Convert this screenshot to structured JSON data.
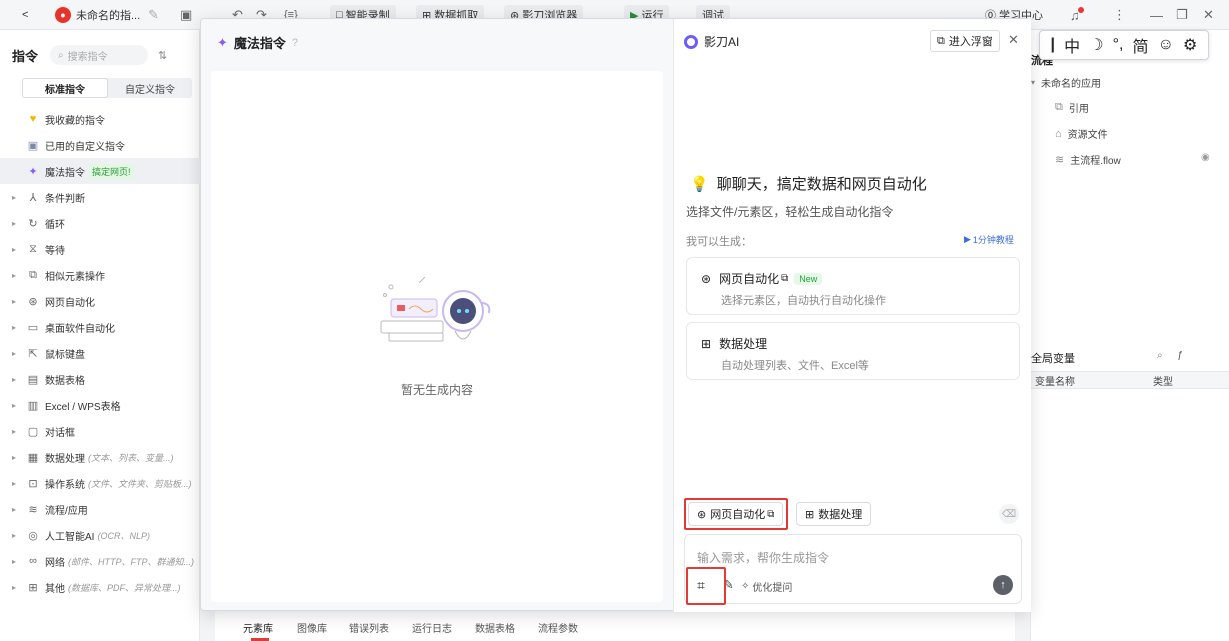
{
  "topbar": {
    "back": "<",
    "app_title": "未命名的指...",
    "smart_record": "智能录制",
    "data_capture": "数据抓取",
    "browser": "影刀浏览器",
    "run": "运行",
    "debug": "调试",
    "learn": "学习中心",
    "window_controls": [
      "⋮",
      "—",
      "❐",
      "✕"
    ]
  },
  "sidebar": {
    "title": "指令",
    "search_placeholder": "搜索指令",
    "tabs": [
      "标准指令",
      "自定义指令"
    ],
    "special_rows": [
      {
        "icon": "heart-icon",
        "label": "我收藏的指令"
      },
      {
        "icon": "bag-icon",
        "label": "已用的自定义指令"
      },
      {
        "icon": "sparkle-icon",
        "label": "魔法指令",
        "tag": "搞定网页!"
      }
    ],
    "groups": [
      {
        "label": "条件判断",
        "hint": ""
      },
      {
        "label": "循环",
        "hint": ""
      },
      {
        "label": "等待",
        "hint": ""
      },
      {
        "label": "相似元素操作",
        "hint": ""
      },
      {
        "label": "网页自动化",
        "hint": ""
      },
      {
        "label": "桌面软件自动化",
        "hint": ""
      },
      {
        "label": "鼠标键盘",
        "hint": ""
      },
      {
        "label": "数据表格",
        "hint": ""
      },
      {
        "label": "Excel / WPS表格",
        "hint": ""
      },
      {
        "label": "对话框",
        "hint": ""
      },
      {
        "label": "数据处理",
        "hint": "(文本、列表、变量...)"
      },
      {
        "label": "操作系统",
        "hint": "(文件、文件夹、剪贴板...)"
      },
      {
        "label": "流程/应用",
        "hint": ""
      },
      {
        "label": "人工智能AI",
        "hint": "(OCR、NLP)"
      },
      {
        "label": "网络",
        "hint": "(邮件、HTTP、FTP、群通知...)"
      },
      {
        "label": "其他",
        "hint": "(数据库、PDF、异常处理...)"
      }
    ]
  },
  "modal": {
    "title": "魔法指令",
    "empty_text": "暂无生成内容",
    "ai_title": "影刀AI",
    "float_button": "进入浮窗",
    "welcome": "聊聊天，搞定数据和网页自动化",
    "welcome_sub": "选择文件/元素区，轻松生成自动化指令",
    "can_generate": "我可以生成：",
    "tutorial": "1分钟教程",
    "cards": [
      {
        "title": "网页自动化",
        "tag": "New",
        "sub": "选择元素区，自动执行自动化操作"
      },
      {
        "title": "数据处理",
        "tag": "",
        "sub": "自动处理列表、文件、Excel等"
      }
    ],
    "chips": [
      "网页自动化",
      "数据处理"
    ],
    "input_placeholder": "输入需求，帮你生成指令",
    "optimize": "优化提问"
  },
  "rightpanel": {
    "flow_label": "流程",
    "app_name": "未命名的应用",
    "items": [
      "引用",
      "资源文件",
      "主流程.flow"
    ],
    "globals_title": "全局变量",
    "col_name": "变量名称",
    "col_type": "类型"
  },
  "ime": [
    "中",
    "°,",
    "简"
  ],
  "bottom_tabs": [
    "元素库",
    "图像库",
    "错误列表",
    "运行日志",
    "数据表格",
    "流程参数"
  ]
}
